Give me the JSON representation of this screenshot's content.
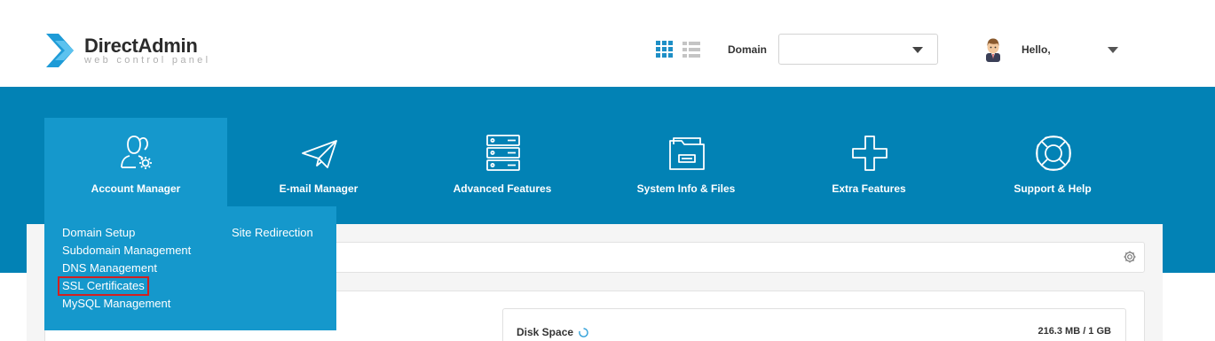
{
  "header": {
    "logo_title": "DirectAdmin",
    "logo_subtitle": "web control panel",
    "domain_label": "Domain",
    "domain_value": "",
    "greeting": "Hello,"
  },
  "nav": [
    {
      "label": "Account Manager",
      "icon": "users-gear-icon",
      "active": true
    },
    {
      "label": "E-mail Manager",
      "icon": "paper-plane-icon",
      "active": false
    },
    {
      "label": "Advanced Features",
      "icon": "server-database-icon",
      "active": false
    },
    {
      "label": "System Info & Files",
      "icon": "folder-icon",
      "active": false
    },
    {
      "label": "Extra Features",
      "icon": "plus-icon",
      "active": false
    },
    {
      "label": "Support & Help",
      "icon": "lifebuoy-icon",
      "active": false
    }
  ],
  "dropdown": {
    "col1": [
      "Domain Setup",
      "Subdomain Management",
      "DNS Management",
      "SSL Certificates",
      "MySQL Management"
    ],
    "col2": [
      "Site Redirection"
    ],
    "highlighted": "SSL Certificates"
  },
  "stats": {
    "disk_label": "Disk Space",
    "disk_value": "216.3 MB / 1 GB"
  },
  "colors": {
    "brand_blue": "#0282b5",
    "active_blue": "#1598cc",
    "logo_blue": "#1e9bd7",
    "highlight_red": "#d32020"
  }
}
